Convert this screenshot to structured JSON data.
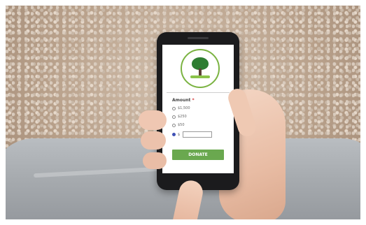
{
  "form": {
    "amount_label": "Amount",
    "required_mark": "*",
    "options": [
      "$1,500",
      "$250",
      "$50"
    ],
    "custom_prefix": "$",
    "selected_index": 3,
    "donate_label": "DONATE"
  },
  "logo": {
    "icon": "tree-logo-icon"
  },
  "colors": {
    "accent_green": "#6aa84f",
    "required_red": "#d32f2f"
  }
}
